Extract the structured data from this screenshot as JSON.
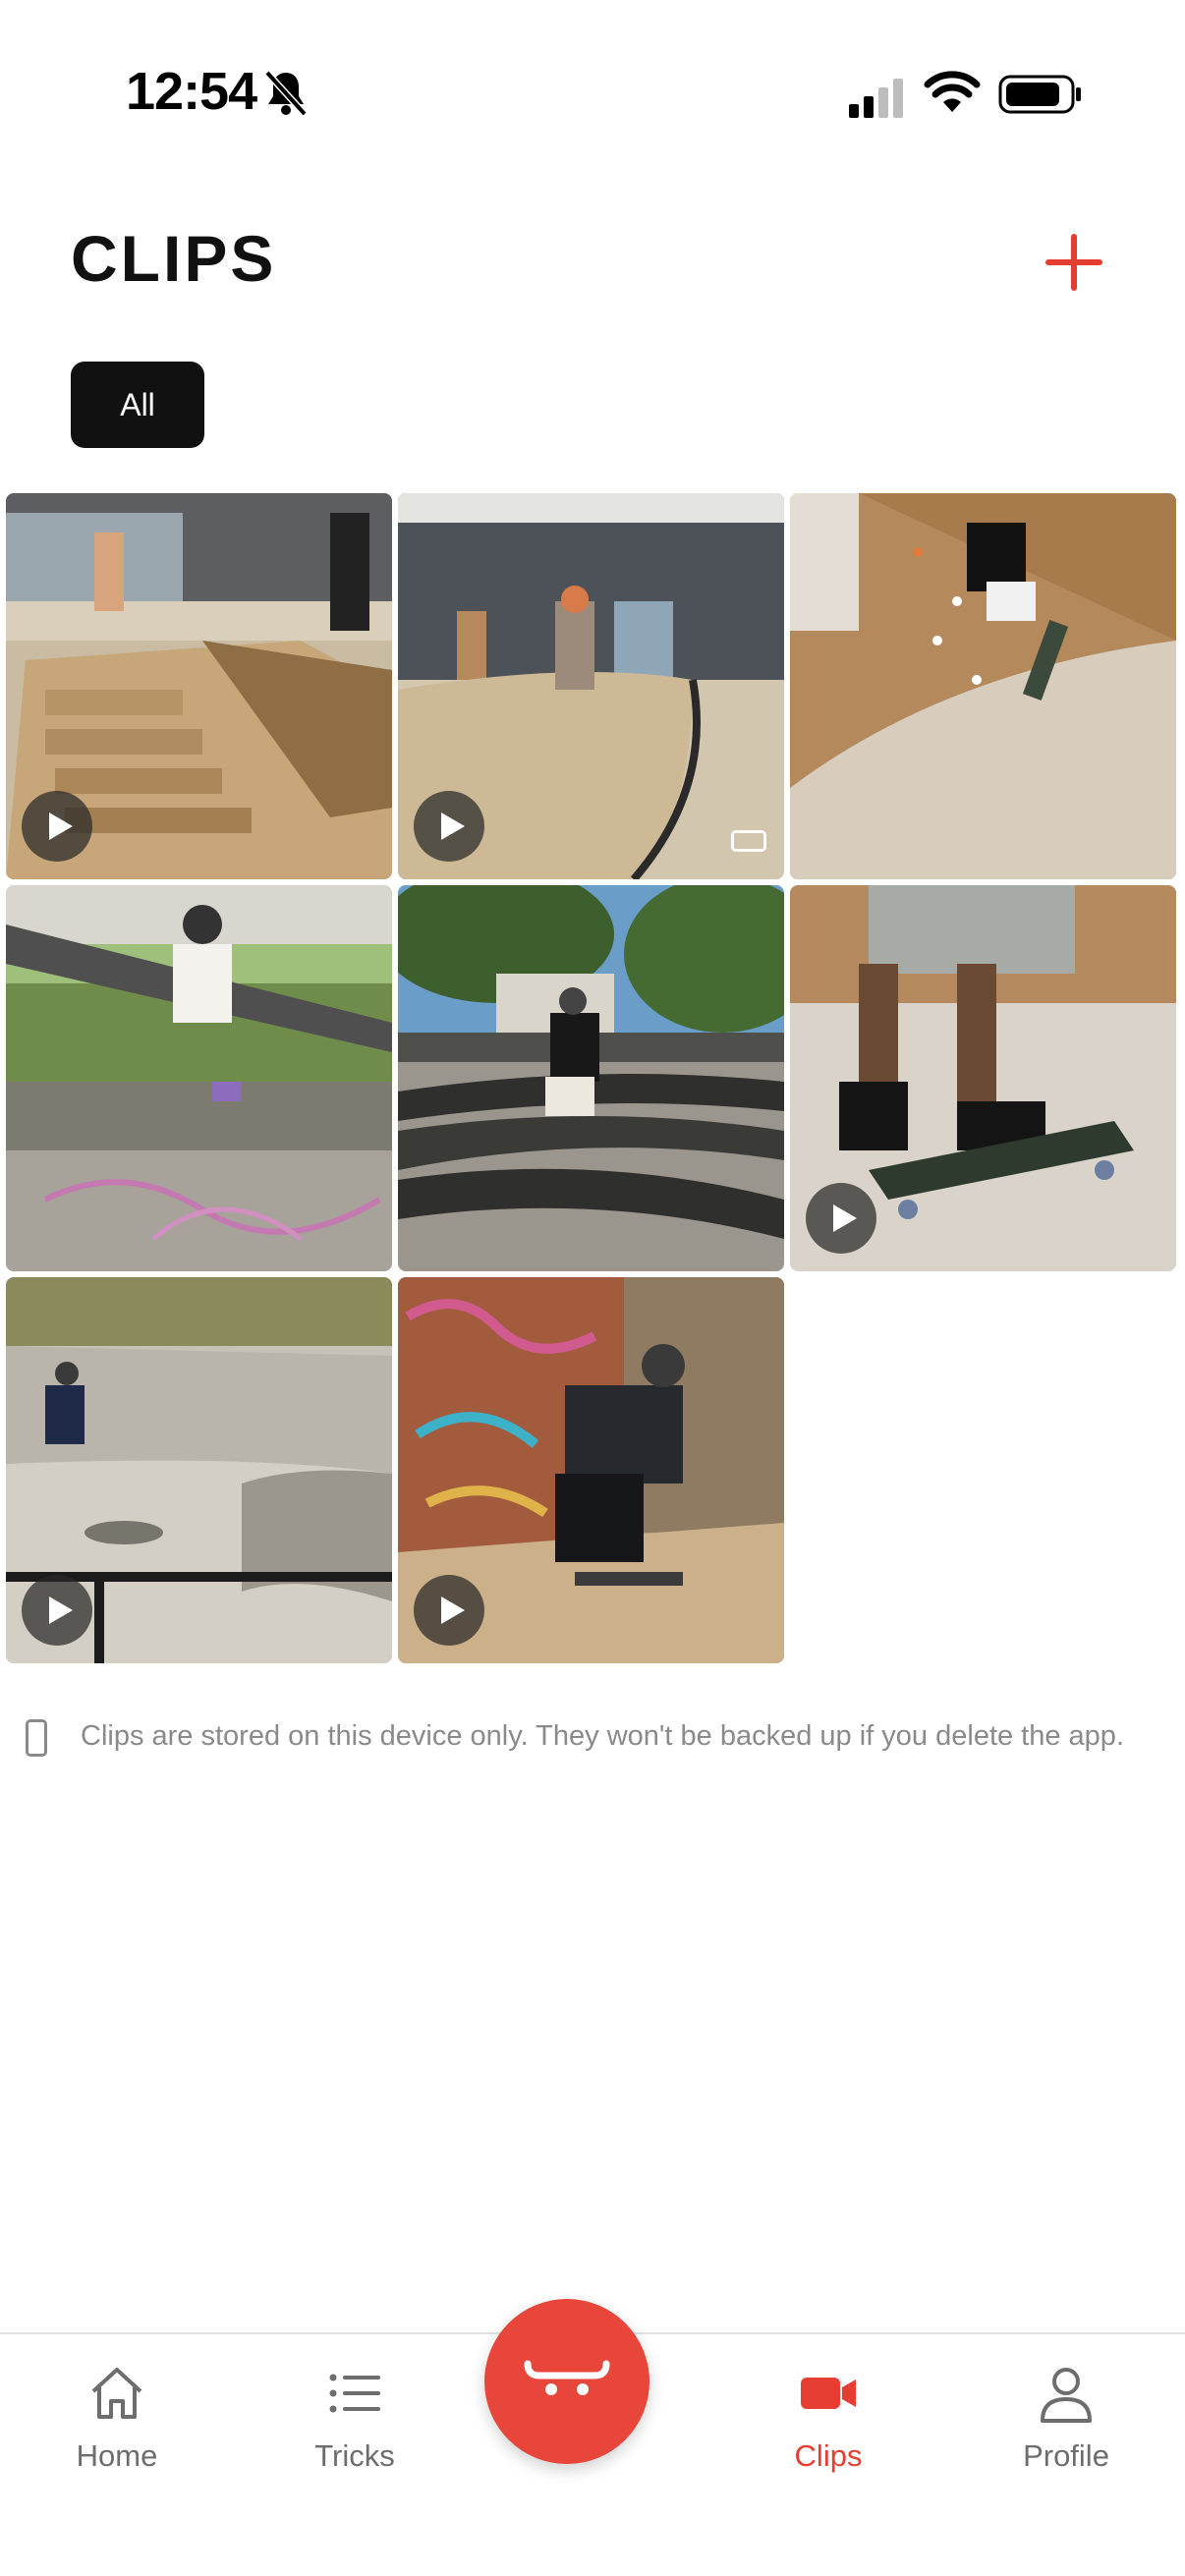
{
  "status_bar": {
    "time": "12:54",
    "icons": [
      "bell-slash-icon",
      "cellular-signal-icon",
      "wifi-icon",
      "battery-icon"
    ]
  },
  "header": {
    "title": "CLIPS",
    "add_icon": "plus-icon"
  },
  "filters": {
    "selected": "All"
  },
  "clips": {
    "items": [
      {
        "scene": "indoor skatepark with stairs and ledge",
        "play_icon": true,
        "orientation_badge": false
      },
      {
        "scene": "indoor bowl with grey walls",
        "play_icon": true,
        "orientation_badge": true
      },
      {
        "scene": "wooden climbing-wall halfpipe",
        "play_icon": false,
        "orientation_badge": false
      },
      {
        "scene": "outdoor jump under shelter with graffiti",
        "play_icon": false,
        "orientation_badge": false
      },
      {
        "scene": "outdoor concrete ledges under trees",
        "play_icon": false,
        "orientation_badge": false
      },
      {
        "scene": "close-up of feet on skateboard",
        "play_icon": true,
        "orientation_badge": false
      },
      {
        "scene": "outdoor concrete bowl with rail",
        "play_icon": true,
        "orientation_badge": false
      },
      {
        "scene": "graffiti brick wall indoor ramp",
        "play_icon": true,
        "orientation_badge": false
      }
    ]
  },
  "notice": {
    "icon": "phone-device-icon",
    "text": "Clips are stored on this device only. They won't be backed up if you delete the app."
  },
  "tab_bar": {
    "tabs": [
      {
        "label": "Home",
        "icon": "home-icon",
        "active": false
      },
      {
        "label": "Tricks",
        "icon": "list-icon",
        "active": false
      },
      {
        "label": "Clips",
        "icon": "video-camera-icon",
        "active": true
      },
      {
        "label": "Profile",
        "icon": "person-icon",
        "active": false
      }
    ],
    "center_action_icon": "skateboard-icon"
  },
  "colors": {
    "accent": "#e53e31",
    "chip_bg": "#111111",
    "muted_text": "#8a8a8a",
    "tab_inactive": "#6d6d6d"
  }
}
